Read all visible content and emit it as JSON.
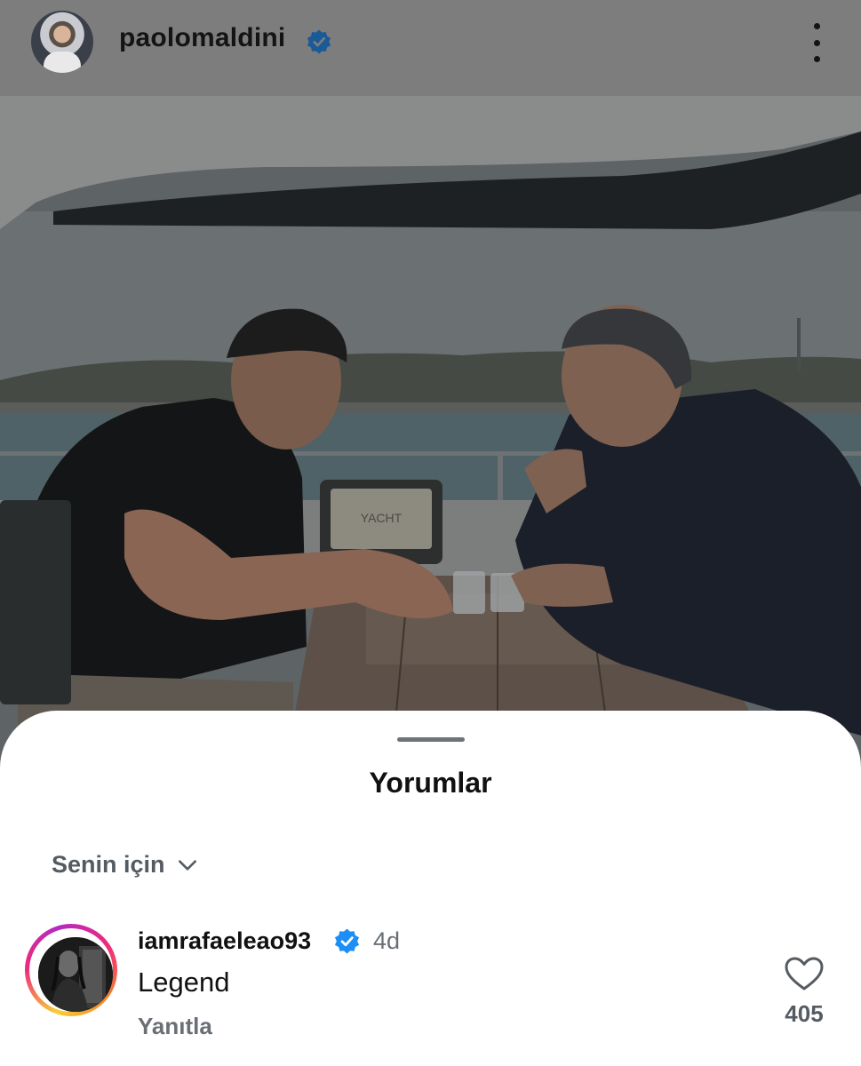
{
  "post": {
    "author": {
      "username": "paolomaldini",
      "verified": true,
      "avatar": "profile-photo"
    },
    "menu_icon": "more-vertical-icon",
    "photo": {
      "description_icon": "post-photo",
      "printed_text": "YACHT"
    }
  },
  "comments_sheet": {
    "title": "Yorumlar",
    "sort": {
      "label": "Senin için",
      "icon": "chevron-down-icon"
    },
    "comments": [
      {
        "username": "iamrafaeleao93",
        "verified": true,
        "time": "4d",
        "text": "Legend",
        "reply_label": "Yanıtla",
        "likes": "405",
        "has_story": true
      }
    ]
  },
  "colors": {
    "verified_blue": "#1d8ef5",
    "dim_overlay": "#7d7d7d",
    "sheet_bg": "#ffffff",
    "secondary_text": "#6a6f75"
  }
}
